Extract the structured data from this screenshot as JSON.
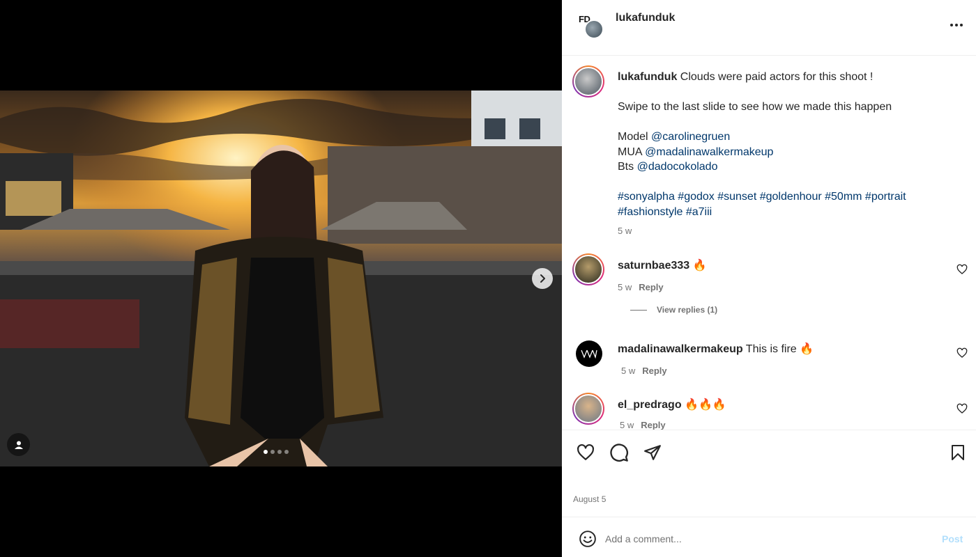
{
  "post": {
    "username": "lukafunduk",
    "header_badge": "FD",
    "media": {
      "slides_total": 4,
      "active_slide": 1
    },
    "caption": {
      "username": "lukafunduk",
      "line1": "Clouds were paid actors for this shoot !",
      "line2": "Swipe to the last slide to see how we made this happen",
      "model_label": "Model",
      "model_handle": "@carolinegruen",
      "mua_label": "MUA",
      "mua_handle": "@madalinawalkermakeup",
      "bts_label": "Bts",
      "bts_handle": "@dadocokolado",
      "hashtags_line1": "#sonyalpha #godox #sunset #goldenhour #50mm #portrait",
      "hashtags_line2": "#fashionstyle #a7iii",
      "time": "5 w"
    },
    "comments": [
      {
        "username": "saturnbae333",
        "text": "🔥",
        "time": "5 w",
        "reply_label": "Reply",
        "view_replies": "View replies (1)"
      },
      {
        "username": "madalinawalkermakeup",
        "text": "This is fire 🔥",
        "time": "5 w",
        "reply_label": "Reply"
      },
      {
        "username": "el_predrago",
        "text": "🔥🔥🔥",
        "time": "5 w",
        "reply_label": "Reply"
      }
    ],
    "date": "August 5",
    "add_comment": {
      "placeholder": "Add a comment...",
      "post_label": "Post"
    }
  },
  "icons": {
    "more": "more-options-icon",
    "next": "chevron-right-icon",
    "tag": "user-tag-icon",
    "like": "heart-icon",
    "comment": "comment-icon",
    "share": "paper-plane-icon",
    "save": "bookmark-icon",
    "emoji": "emoji-icon"
  },
  "colors": {
    "link": "#00376b",
    "muted": "#737373",
    "post_disabled": "#b2dffc"
  }
}
